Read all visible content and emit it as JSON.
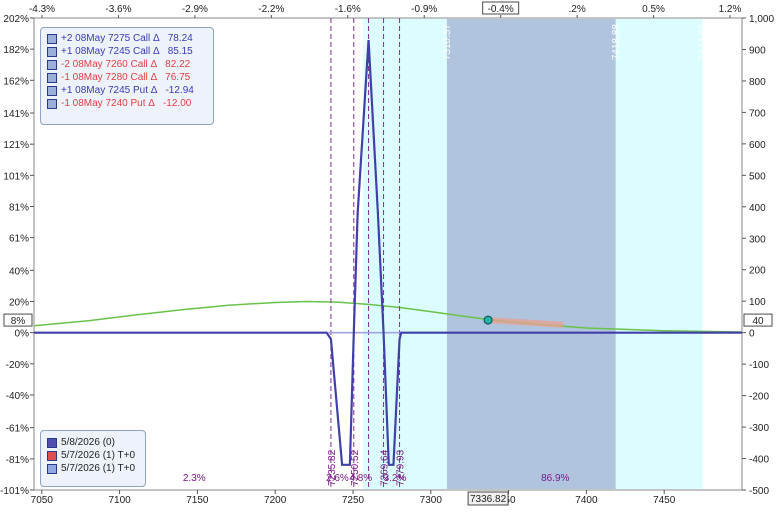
{
  "chart_data": {
    "type": "line",
    "top_axis": {
      "ticks": [
        "-4.3%",
        "-3.6%",
        "-2.9%",
        "-2.2%",
        "-1.6%",
        "-0.9%",
        "-0.4%",
        ".2%",
        "0.5%",
        "1.2%"
      ],
      "values": [
        -4.3,
        -3.6,
        -2.9,
        -2.2,
        -1.6,
        -0.9,
        -0.4,
        0.2,
        0.5,
        1.2
      ],
      "highlight": "-0.4%"
    },
    "x_axis": {
      "range": [
        7045,
        7500
      ],
      "ticks": [
        7050,
        7100,
        7150,
        7200,
        7250,
        7300,
        7350,
        7400,
        7450
      ],
      "ticks_labels": [
        "7050",
        "7100",
        "7150",
        "7200",
        "7250",
        "7300",
        ".50",
        "7400",
        "7450"
      ],
      "current_price_label": "7336.82"
    },
    "left_axis": {
      "range": [
        -101,
        202
      ],
      "ticks": [
        "202%",
        "182%",
        "162%",
        "141%",
        "121%",
        "101%",
        "81%",
        "61%",
        "40%",
        "20%",
        "0%",
        "-20%",
        "-40%",
        "-61%",
        "-81%",
        "-101%"
      ],
      "values": [
        202,
        182,
        162,
        141,
        121,
        101,
        81,
        61,
        40,
        20,
        0,
        -20,
        -40,
        -61,
        -81,
        -101
      ],
      "marker": "8%"
    },
    "right_axis": {
      "range": [
        -500,
        1000
      ],
      "ticks": [
        "1,000",
        "900",
        "800",
        "700",
        "600",
        "500",
        "400",
        "300",
        "200",
        "100",
        "0",
        "-100",
        "-200",
        "-300",
        "-400",
        "-500"
      ],
      "values": [
        1000,
        900,
        800,
        700,
        600,
        500,
        400,
        300,
        200,
        100,
        0,
        -100,
        -200,
        -300,
        -400,
        -500
      ],
      "marker": "40"
    },
    "shaded_regions": [
      {
        "x0": 7256.5,
        "x1": 7310.37,
        "color": "#dcfdff"
      },
      {
        "x0": 7310.37,
        "x1": 7418.88,
        "color": "#b0c4de"
      },
      {
        "x0": 7418.88,
        "x1": 7474.63,
        "color": "#dcfdff"
      }
    ],
    "region_labels": [
      {
        "text": "7310.37",
        "x": 7310.37
      },
      {
        "text": "7418.88",
        "x": 7418.88
      },
      {
        "text": "7474.63",
        "x": 7474.63
      },
      {
        "text": "7256.61",
        "x": 7256.61
      }
    ],
    "strike_lines": [
      7235.82,
      7250.52,
      7269.64,
      7279.93,
      7260
    ],
    "strike_labels": [
      {
        "text": "7235.82",
        "x": 7235.82
      },
      {
        "text": "7250.52",
        "x": 7250.52
      },
      {
        "text": "7269.64",
        "x": 7269.64
      },
      {
        "text": "7279.93",
        "x": 7279.93
      }
    ],
    "bottom_labels": [
      {
        "text": "2.3%",
        "x": 7148
      },
      {
        "text": "2.6%",
        "x": 7240
      },
      {
        "text": "4.8%",
        "x": 7255
      },
      {
        "text": "3.2%",
        "x": 7277
      },
      {
        "text": "86.9%",
        "x": 7380
      }
    ],
    "series": [
      {
        "name": "5/8/2026 (0)",
        "color": "#4040a8",
        "x": [
          7045,
          7233,
          7235.82,
          7243,
          7248,
          7250.52,
          7253,
          7260,
          7266,
          7269.64,
          7273,
          7276,
          7279.93,
          7281,
          7500
        ],
        "y": [
          0,
          0,
          -20,
          -420,
          -420,
          0,
          380,
          930,
          380,
          0,
          -420,
          -420,
          -20,
          0,
          0
        ]
      },
      {
        "name": "5/7/2026 (1) T+0",
        "color": "#e05050",
        "x": [
          7336.82,
          7385
        ],
        "y": [
          40,
          25
        ]
      },
      {
        "name": "5/7/2026 (1) T+0",
        "color": "#a0a0e8",
        "x": [
          7045,
          7350,
          7500
        ],
        "y": [
          0,
          0,
          0
        ]
      }
    ],
    "probability_curve": {
      "color": "#6ac24a",
      "x": [
        7045,
        7080,
        7110,
        7140,
        7170,
        7200,
        7220,
        7240,
        7260,
        7280,
        7300,
        7320,
        7340,
        7370,
        7400,
        7450,
        7500
      ],
      "y": [
        22,
        38,
        56,
        73,
        87,
        96,
        99,
        97,
        90,
        80,
        67,
        53,
        40,
        26,
        15,
        6,
        2
      ]
    },
    "current_point": {
      "x": 7336.82,
      "y": 40
    },
    "legend_positions": [
      {
        "label": "+2 08May 7275 Call Δ",
        "value": "78.24",
        "color": "#3a3ab8"
      },
      {
        "label": "+1 08May 7245 Call Δ",
        "value": "85.15",
        "color": "#3a3ab8"
      },
      {
        "label": "-2 08May 7260 Call Δ",
        "value": "82.22",
        "color": "#e04040"
      },
      {
        "label": "-1 08May 7280 Call Δ",
        "value": "76.75",
        "color": "#e04040"
      },
      {
        "label": "+1 08May 7245 Put Δ",
        "value": "-12.94",
        "color": "#3a3ab8"
      },
      {
        "label": "-1 08May 7240 Put Δ",
        "value": "-12.00",
        "color": "#e04040"
      }
    ],
    "legend_series": [
      {
        "label": "5/8/2026 (0)",
        "color": "#5050b0"
      },
      {
        "label": "5/7/2026 (1) T+0",
        "color": "#e05050"
      },
      {
        "label": "5/7/2026 (1) T+0",
        "color": "#8fa8e0"
      }
    ]
  }
}
